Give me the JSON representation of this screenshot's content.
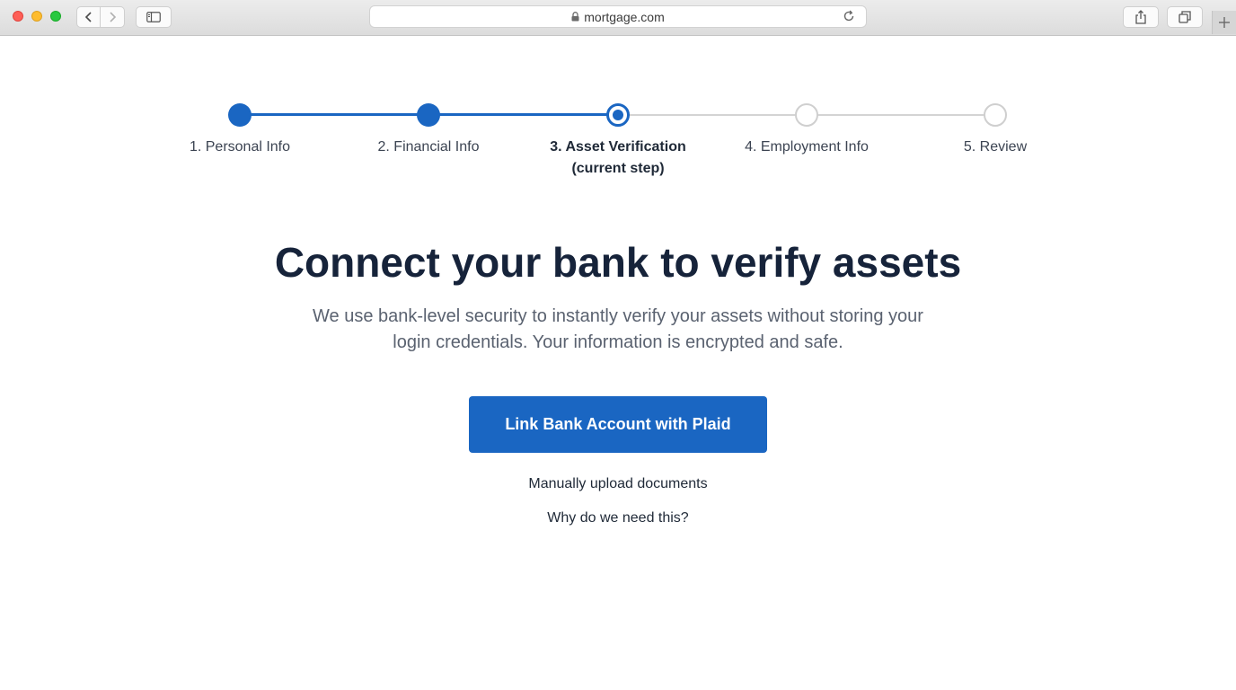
{
  "browser": {
    "url": "mortgage.com"
  },
  "stepper": {
    "steps": [
      {
        "label": "1. Personal Info",
        "status": "completed"
      },
      {
        "label": "2. Financial Info",
        "status": "completed"
      },
      {
        "label": "3. Asset Verification",
        "sublabel": "(current step)",
        "status": "current"
      },
      {
        "label": "4. Employment Info",
        "status": "upcoming"
      },
      {
        "label": "5. Review",
        "status": "upcoming"
      }
    ]
  },
  "main": {
    "headline": "Connect your bank to verify assets",
    "description": "We use bank-level security to instantly verify your assets without storing your login credentials. Your information is encrypted and safe.",
    "primary_button": "Link Bank Account with Plaid",
    "manual_upload_link": "Manually upload documents",
    "why_link": "Why do we need this?"
  },
  "colors": {
    "accent": "#1a66c2",
    "heading": "#16233a",
    "body_text": "#5a6270",
    "inactive": "#d4d4d4"
  },
  "icons": [
    "chevron-left-icon",
    "chevron-right-icon",
    "sidebar-icon",
    "lock-icon",
    "reload-icon",
    "share-icon",
    "tabs-icon",
    "plus-icon"
  ]
}
